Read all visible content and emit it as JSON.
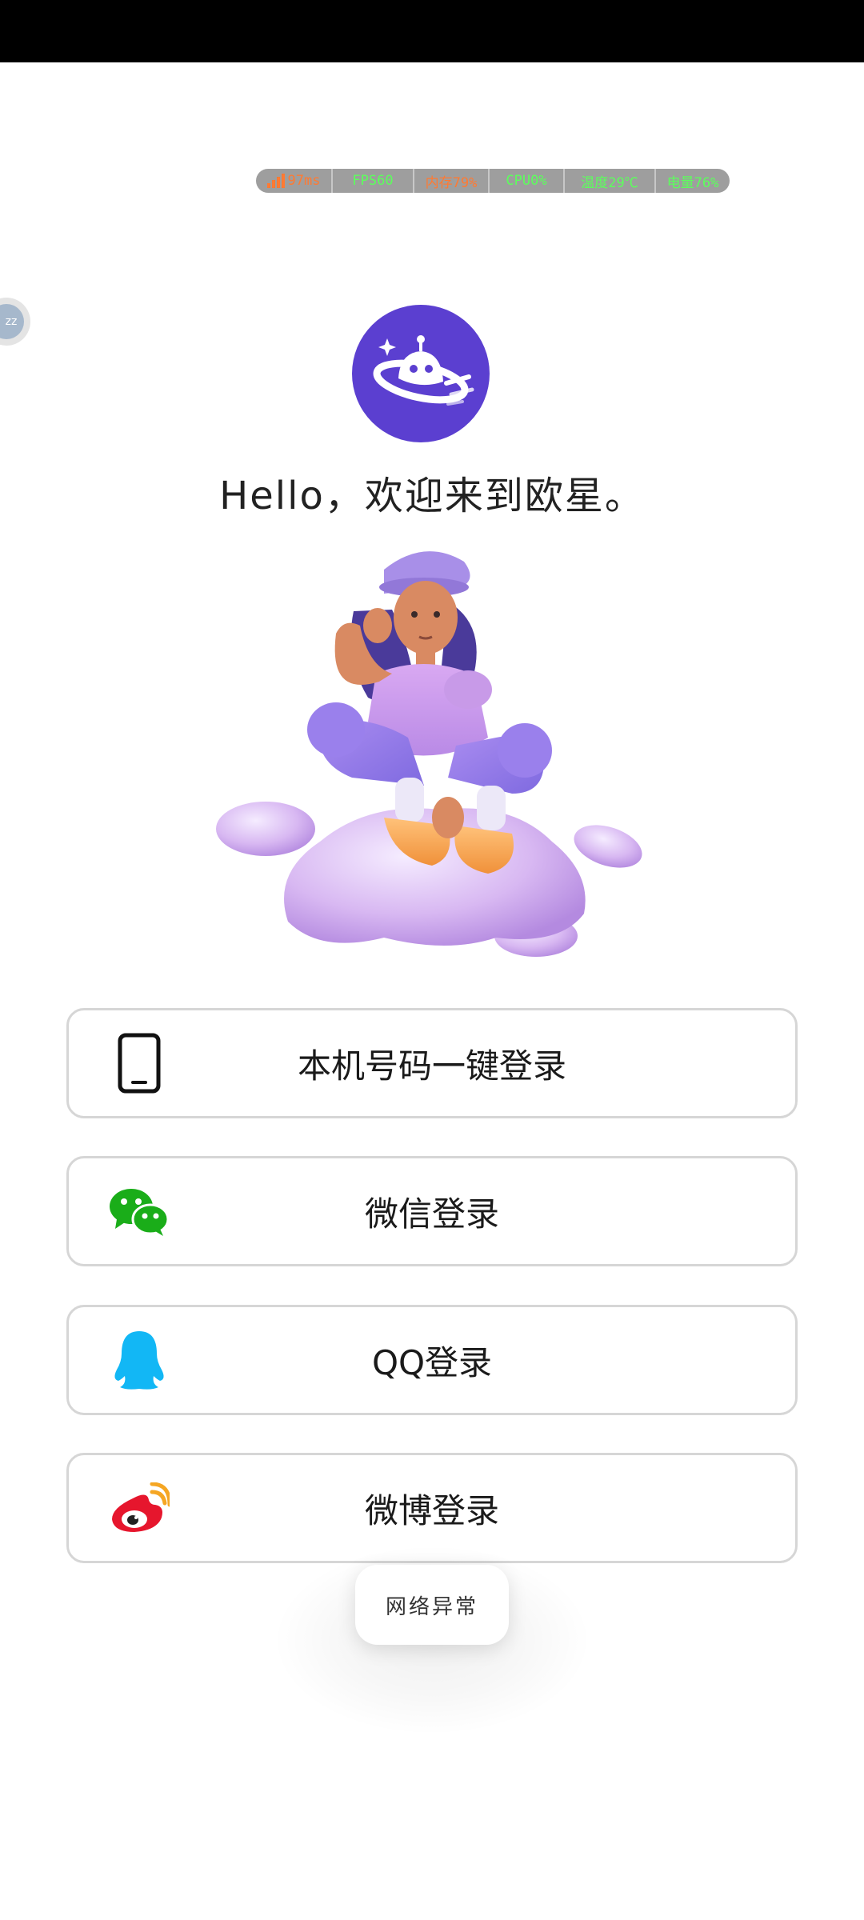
{
  "perf_overlay": {
    "signal": "97ms",
    "fps": "FPS60",
    "memory": "内存79%",
    "cpu": "CPU0%",
    "temperature": "温度29℃",
    "battery": "电量76%"
  },
  "side_bubble": {
    "text": "zz"
  },
  "greeting": "Hello，欢迎来到欧星。",
  "login_buttons": [
    {
      "label": "本机号码一键登录",
      "icon": "phone-icon"
    },
    {
      "label": "微信登录",
      "icon": "wechat-icon"
    },
    {
      "label": "QQ登录",
      "icon": "qq-icon"
    },
    {
      "label": "微博登录",
      "icon": "weibo-icon"
    }
  ],
  "toast": "网络异常",
  "colors": {
    "logo_bg": "#5b3fd0",
    "wechat": "#1aad19",
    "qq": "#12b7f5",
    "weibo": "#e6162d",
    "weibo_accent": "#f5a623",
    "button_border": "#d6d6d6"
  }
}
